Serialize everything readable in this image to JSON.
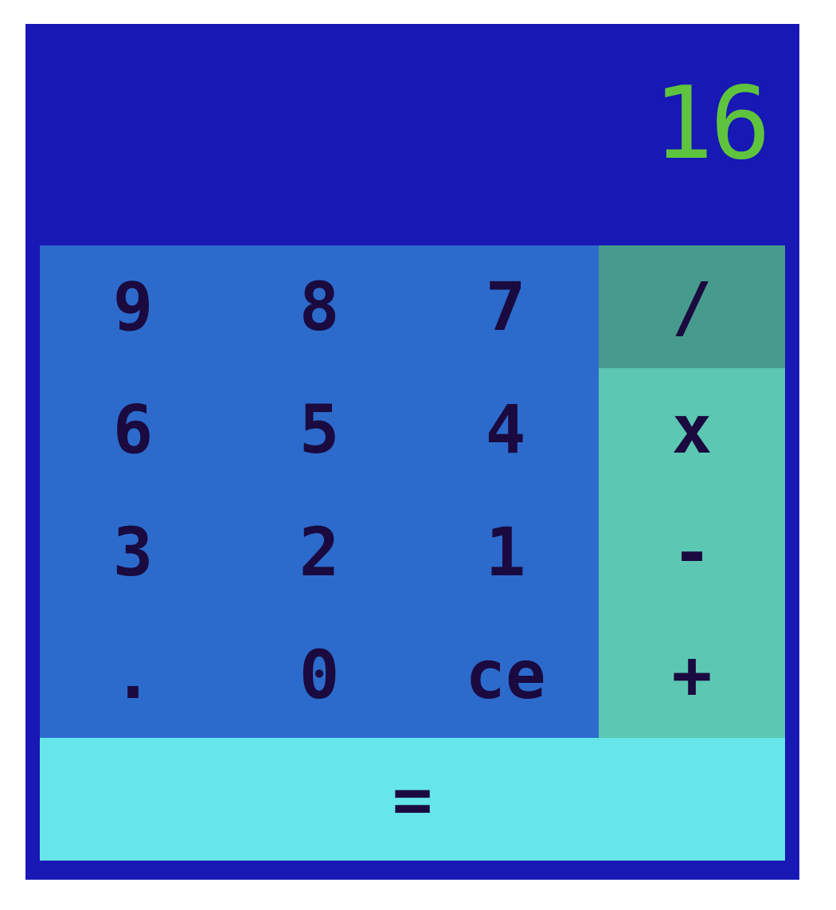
{
  "display": {
    "value": "16"
  },
  "keys": {
    "nine": "9",
    "eight": "8",
    "seven": "7",
    "six": "6",
    "five": "5",
    "four": "4",
    "three": "3",
    "two": "2",
    "one": "1",
    "decimal": ".",
    "zero": "0",
    "clear": "ce",
    "divide": "/",
    "multiply": "x",
    "subtract": "-",
    "add": "+",
    "equals": "="
  },
  "colors": {
    "frame": "#1818b5",
    "display_text": "#5fc43d",
    "digit_pad": "#2c6bcc",
    "operator_pad": "#5cc7b3",
    "operator_active": "#479b8d",
    "equals_bg": "#66e5ea",
    "key_text": "#1a0a3f"
  }
}
